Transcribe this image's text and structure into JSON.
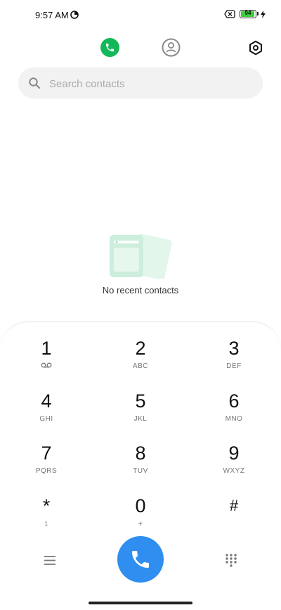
{
  "status_bar": {
    "time": "9:57 AM",
    "battery": "94",
    "battery_level": 0.94,
    "icons": [
      "data-saver-icon",
      "no-sim-icon",
      "battery-icon",
      "charging-bolt-icon"
    ]
  },
  "tabs": [
    {
      "name": "recents",
      "icon": "phone-icon",
      "active": true
    },
    {
      "name": "contacts",
      "icon": "person-icon",
      "active": false
    }
  ],
  "settings": {
    "icon": "gear-icon"
  },
  "search": {
    "placeholder": "Search contacts",
    "value": ""
  },
  "empty_state": {
    "text": "No recent contacts"
  },
  "dialpad": {
    "keys": [
      {
        "digit": "1",
        "letters": ""
      },
      {
        "digit": "2",
        "letters": "ABC"
      },
      {
        "digit": "3",
        "letters": "DEF"
      },
      {
        "digit": "4",
        "letters": "GHI"
      },
      {
        "digit": "5",
        "letters": "JKL"
      },
      {
        "digit": "6",
        "letters": "MNO"
      },
      {
        "digit": "7",
        "letters": "PQRS"
      },
      {
        "digit": "8",
        "letters": "TUV"
      },
      {
        "digit": "9",
        "letters": "WXYZ"
      },
      {
        "digit": "*",
        "letters": "1"
      },
      {
        "digit": "0",
        "letters": "+"
      },
      {
        "digit": "#",
        "letters": ""
      }
    ]
  },
  "colors": {
    "accent_green": "#14b85a",
    "call_blue": "#2f8ef0",
    "battery_green": "#3ccf3c"
  }
}
